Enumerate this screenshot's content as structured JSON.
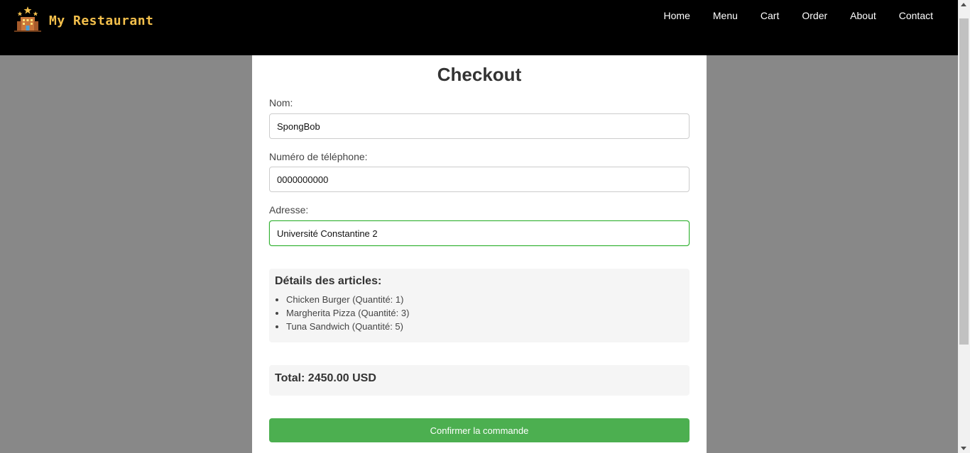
{
  "header": {
    "brand_name": "My Restaurant",
    "nav": [
      "Home",
      "Menu",
      "Cart",
      "Order",
      "About",
      "Contact"
    ]
  },
  "checkout": {
    "title": "Checkout",
    "name_label": "Nom:",
    "name_value": "SpongBob",
    "phone_label": "Numéro de téléphone:",
    "phone_value": "0000000000",
    "address_label": "Adresse:",
    "address_value": "Université Constantine 2",
    "items_title": "Détails des articles:",
    "items": [
      "Chicken Burger (Quantité: 1)",
      "Margherita Pizza (Quantité: 3)",
      "Tuna Sandwich (Quantité: 5)"
    ],
    "total": "Total: 2450.00 USD",
    "confirm_label": "Confirmer la commande"
  },
  "colors": {
    "header_bg": "#000000",
    "brand": "#f4c04c",
    "page_bg": "#888888",
    "accent_green": "#4caf50",
    "focus_border": "#33b233"
  },
  "icons": {
    "logo": "restaurant-building-icon"
  }
}
